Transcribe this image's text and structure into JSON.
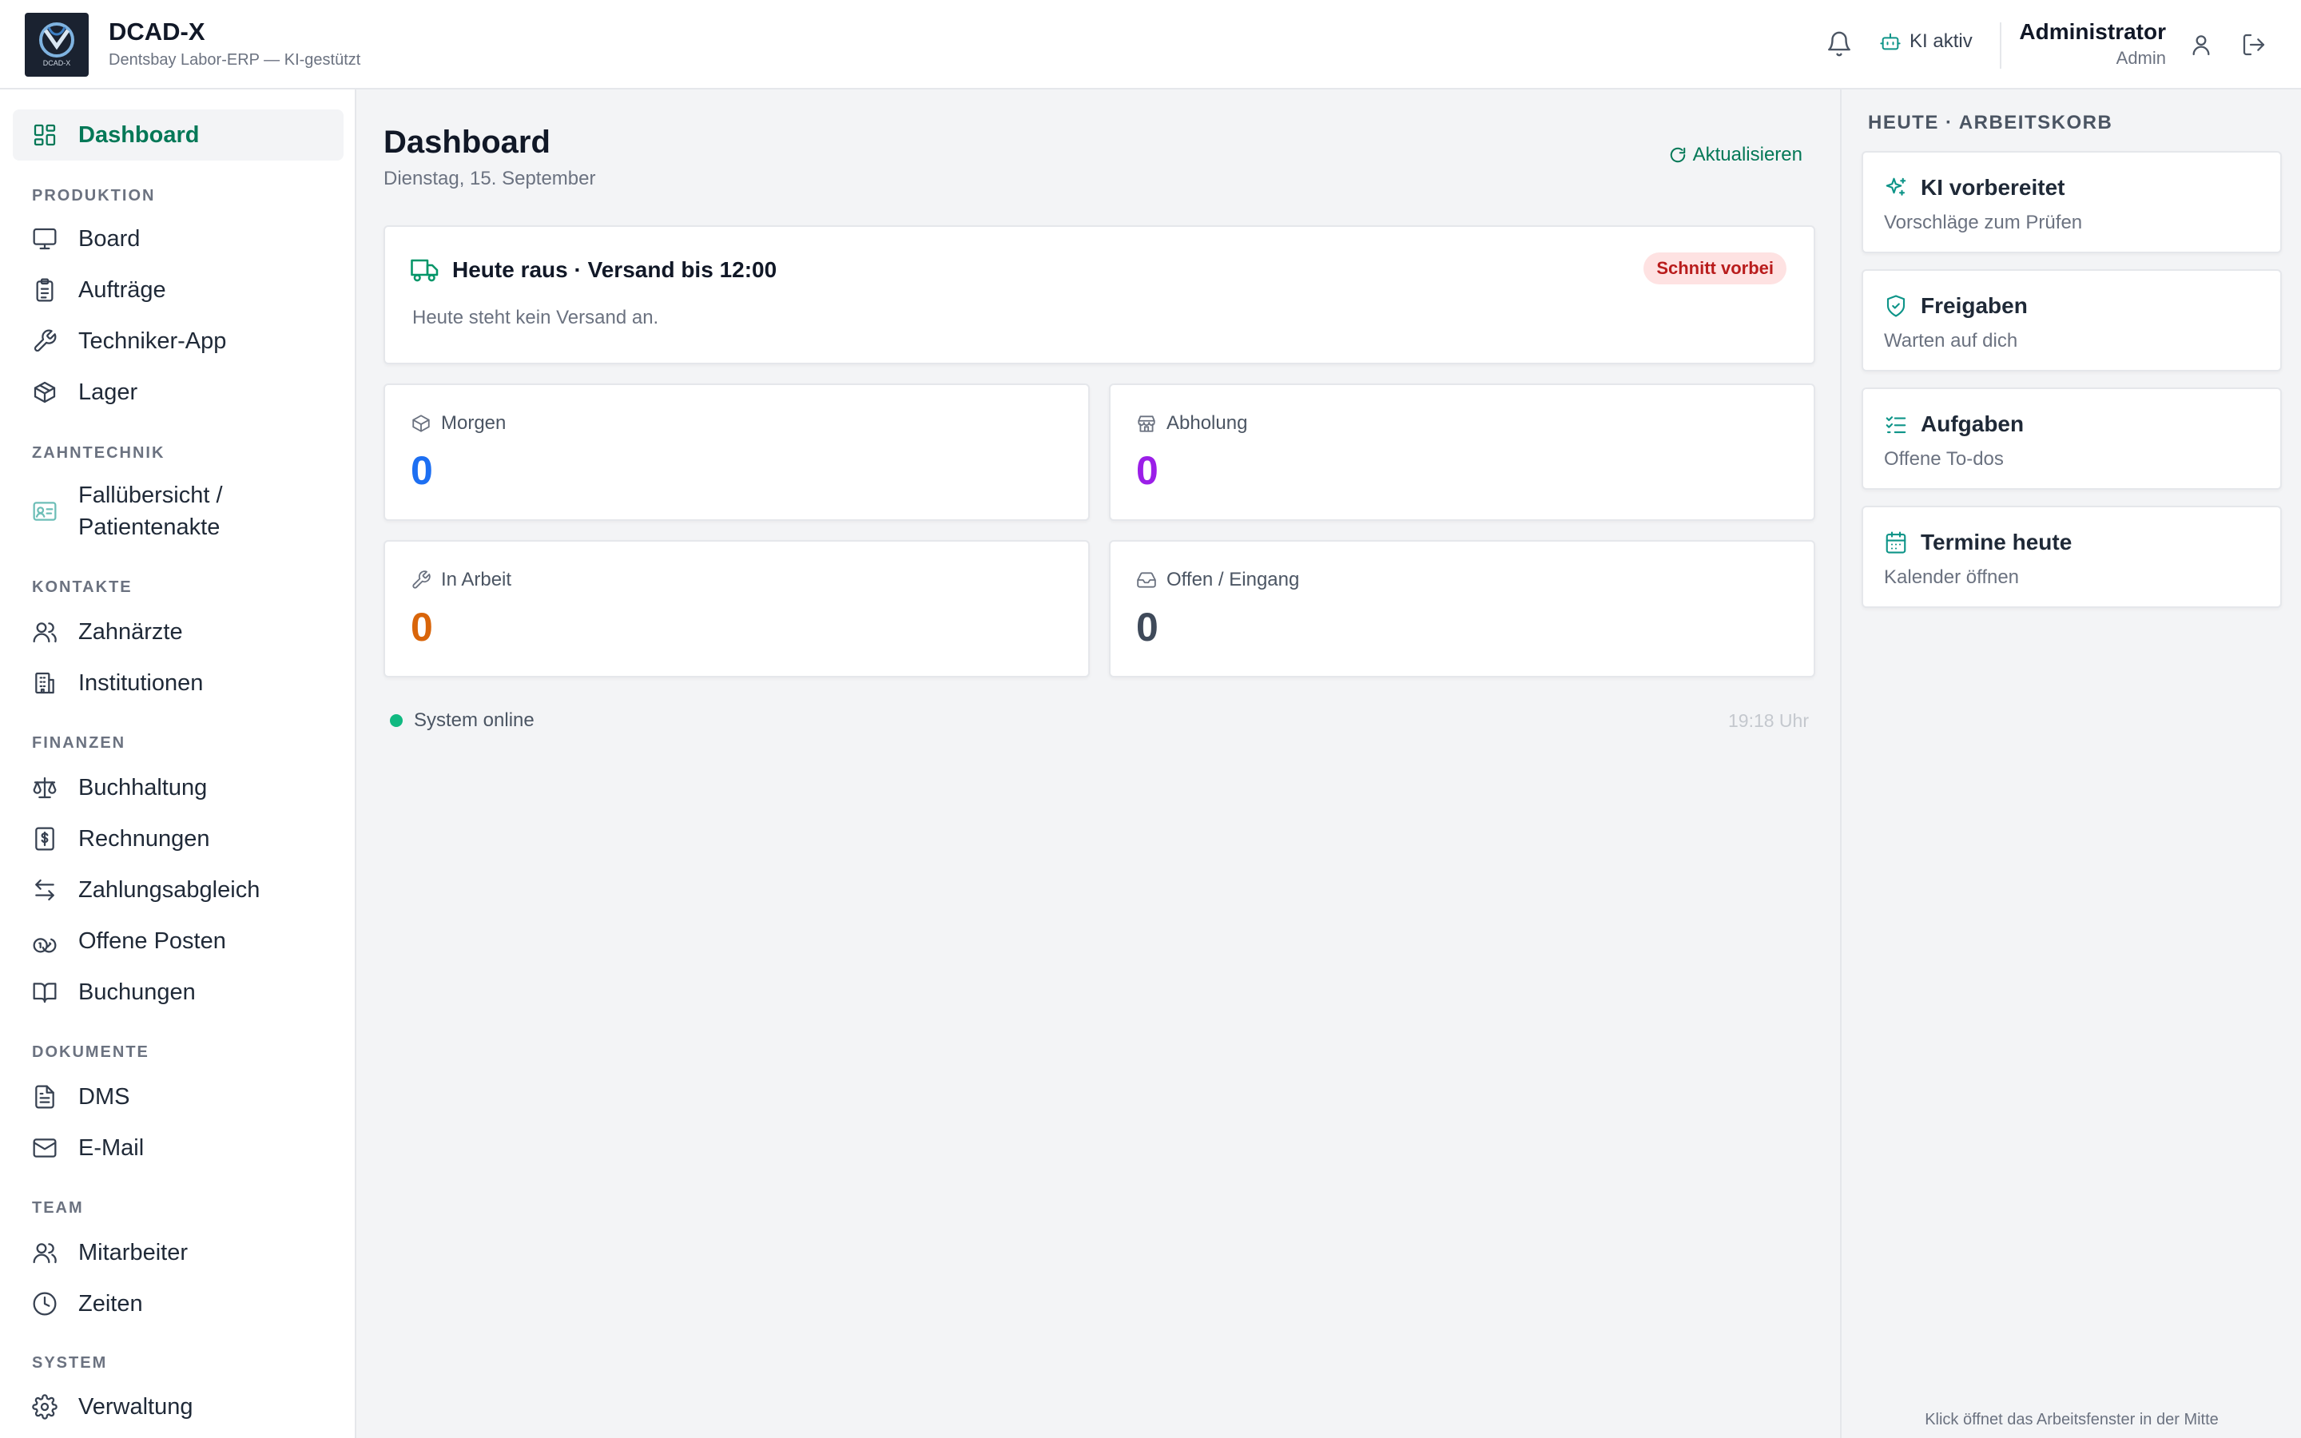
{
  "app": {
    "name": "DCAD-X",
    "subtitle": "Dentsbay Labor-ERP — KI-gestützt",
    "logo_text": "DCAD-X"
  },
  "header": {
    "ki_status": "KI aktiv",
    "user_name": "Administrator",
    "user_role": "Admin"
  },
  "sidebar": {
    "dashboard": "Dashboard",
    "sections": [
      {
        "label": "PRODUKTION",
        "items": [
          {
            "label": "Board",
            "icon": "monitor-icon"
          },
          {
            "label": "Aufträge",
            "icon": "clipboard-icon"
          },
          {
            "label": "Techniker-App",
            "icon": "wrench-icon"
          },
          {
            "label": "Lager",
            "icon": "package-icon"
          }
        ]
      },
      {
        "label": "ZAHNTECHNIK",
        "items": [
          {
            "label": "Fallübersicht / Patientenakte",
            "icon": "patient-card-icon"
          }
        ]
      },
      {
        "label": "KONTAKTE",
        "items": [
          {
            "label": "Zahnärzte",
            "icon": "users-icon"
          },
          {
            "label": "Institutionen",
            "icon": "building-icon"
          }
        ]
      },
      {
        "label": "FINANZEN",
        "items": [
          {
            "label": "Buchhaltung",
            "icon": "scale-icon"
          },
          {
            "label": "Rechnungen",
            "icon": "receipt-icon"
          },
          {
            "label": "Zahlungsabgleich",
            "icon": "arrows-icon"
          },
          {
            "label": "Offene Posten",
            "icon": "coins-icon"
          },
          {
            "label": "Buchungen",
            "icon": "book-icon"
          }
        ]
      },
      {
        "label": "DOKUMENTE",
        "items": [
          {
            "label": "DMS",
            "icon": "file-icon"
          },
          {
            "label": "E-Mail",
            "icon": "mail-icon"
          }
        ]
      },
      {
        "label": "TEAM",
        "items": [
          {
            "label": "Mitarbeiter",
            "icon": "users-icon"
          },
          {
            "label": "Zeiten",
            "icon": "clock-icon"
          }
        ]
      },
      {
        "label": "SYSTEM",
        "items": [
          {
            "label": "Verwaltung",
            "icon": "gear-icon"
          }
        ]
      }
    ]
  },
  "main": {
    "title": "Dashboard",
    "date": "Dienstag, 15. September",
    "refresh_label": "Aktualisieren",
    "shipping": {
      "title": "Heute raus · Versand bis 12:00",
      "badge": "Schnitt vorbei",
      "text": "Heute steht kein Versand an."
    },
    "stats": [
      {
        "label": "Morgen",
        "value": "0",
        "icon": "package-icon",
        "color": "#1d6ff2"
      },
      {
        "label": "Abholung",
        "value": "0",
        "icon": "store-icon",
        "color": "#9b1fe8"
      },
      {
        "label": "In Arbeit",
        "value": "0",
        "icon": "wrench-icon",
        "color": "#d9650a"
      },
      {
        "label": "Offen / Eingang",
        "value": "0",
        "icon": "inbox-icon",
        "color": "#3f4a5a"
      }
    ],
    "system_status": "System online",
    "time": "19:18 Uhr"
  },
  "right_panel": {
    "title": "HEUTE · ARBEITSKORB",
    "cards": [
      {
        "title": "KI vorbereitet",
        "subtitle": "Vorschläge zum Prüfen",
        "icon": "sparkles-icon"
      },
      {
        "title": "Freigaben",
        "subtitle": "Warten auf dich",
        "icon": "shield-check-icon"
      },
      {
        "title": "Aufgaben",
        "subtitle": "Offene To-dos",
        "icon": "checklist-icon"
      },
      {
        "title": "Termine heute",
        "subtitle": "Kalender öffnen",
        "icon": "calendar-icon"
      }
    ],
    "footer": "Klick öffnet das Arbeitsfenster in der Mitte"
  },
  "colors": {
    "accent": "#047857",
    "teal": "#0d9488",
    "badge_bg": "#fee2e2",
    "badge_text": "#b91c1c",
    "online": "#10b981"
  }
}
